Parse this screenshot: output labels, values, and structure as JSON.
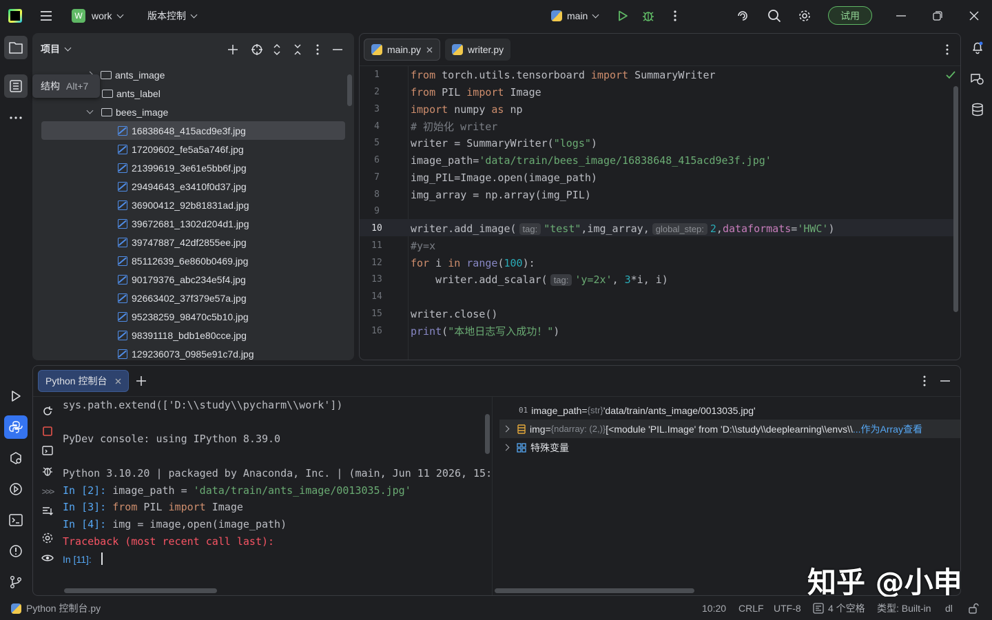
{
  "titlebar": {
    "project_badge": "W",
    "project_name": "work",
    "vcs_label": "版本控制",
    "run_config": "main",
    "trial_label": "试用"
  },
  "tooltip": {
    "label": "结构",
    "shortcut": "Alt+7"
  },
  "project_panel": {
    "title": "项目",
    "folders": [
      "ants_image",
      "ants_label",
      "bees_image"
    ],
    "files": [
      "16838648_415acd9e3f.jpg",
      "17209602_fe5a5a746f.jpg",
      "21399619_3e61e5bb6f.jpg",
      "29494643_e3410f0d37.jpg",
      "36900412_92b81831ad.jpg",
      "39672681_1302d204d1.jpg",
      "39747887_42df2855ee.jpg",
      "85112639_6e860b0469.jpg",
      "90179376_abc234e5f4.jpg",
      "92663402_37f379e57a.jpg",
      "95238259_98470c5b10.jpg",
      "98391118_bdb1e80cce.jpg",
      "129236073_0985e91c7d.jpg"
    ]
  },
  "editor": {
    "tabs": [
      "main.py",
      "writer.py"
    ],
    "line_numbers": [
      "1",
      "2",
      "3",
      "4",
      "5",
      "6",
      "7",
      "8",
      "9",
      "10",
      "11",
      "12",
      "13",
      "14",
      "15",
      "16"
    ],
    "code": {
      "l1_kw1": "from",
      "l1_mod": " torch.utils.tensorboard ",
      "l1_kw2": "import",
      "l1_name": " SummaryWriter",
      "l2_kw1": "from",
      "l2_mod": " PIL ",
      "l2_kw2": "import",
      "l2_name": " Image",
      "l3_kw1": "import",
      "l3_mod": " numpy ",
      "l3_kw2": "as",
      "l3_name": " np",
      "l4": "# 初始化 writer",
      "l5_a": "writer = SummaryWriter(",
      "l5_s": "\"logs\"",
      "l5_b": ")",
      "l6_a": "image_path=",
      "l6_s": "'data/train/bees_image/16838648_415acd9e3f.jpg'",
      "l7": "img_PIL=Image.open(image_path)",
      "l8": "img_array = np.array(img_PIL)",
      "l10_a": "writer.add_image(",
      "l10_h1": "tag:",
      "l10_s": "\"test\"",
      "l10_b": ",img_array,",
      "l10_h2": "global_step:",
      "l10_n": "2",
      "l10_c": ",",
      "l10_p": "dataformats",
      "l10_d": "=",
      "l10_s2": "'HWC'",
      "l10_e": ")",
      "l11": "#y=x",
      "l12_kw1": "for",
      "l12_a": " i ",
      "l12_kw2": "in",
      "l12_b": " ",
      "l12_f": "range",
      "l12_c": "(",
      "l12_n": "100",
      "l12_d": "):",
      "l13_a": "    writer.add_scalar(",
      "l13_h": "tag:",
      "l13_s": "'y=2x'",
      "l13_b": ", ",
      "l13_n": "3",
      "l13_c": "*i, i)",
      "l15": "writer.close()",
      "l16_f": "print",
      "l16_a": "(",
      "l16_s": "\"本地日志写入成功！\"",
      "l16_b": ")"
    }
  },
  "console": {
    "tab_label": "Python 控制台",
    "lines": {
      "c1": "sys.path.extend(['D:\\\\study\\\\pycharm\\\\work'])",
      "c2": "PyDev console: using IPython 8.39.0",
      "c3": "Python 3.10.20 | packaged by Anaconda, Inc. | (main, Jun 11 2026, 15:",
      "c4_p": "In [2]:",
      "c4_a": " image_path = ",
      "c4_s": "'data/train/ants_image/0013035.jpg'",
      "c5_p": "In [3]:",
      "c5_kw1": " from",
      "c5_a": " PIL ",
      "c5_kw2": "import",
      "c5_b": " Image",
      "c6_p": "In [4]:",
      "c6_a": " img = image,open(image_path)",
      "c7": "Traceback (most recent call last):",
      "c8_p": "In [11]:"
    },
    "variables": {
      "v1_name": "image_path",
      "v1_eq": " = ",
      "v1_type": "{str}",
      "v1_val": " 'data/train/ants_image/0013035.jpg'",
      "v2_name": "img",
      "v2_eq": " = ",
      "v2_type": "{ndarray: (2,)}",
      "v2_val": " [<module 'PIL.Image' from 'D:\\\\study\\\\deeplearning\\\\envs\\\\",
      "v2_link": "...作为Array查看",
      "v3_name": "特殊变量"
    }
  },
  "statusbar": {
    "left": "Python 控制台.py",
    "position": "10:20",
    "line_sep": "CRLF",
    "encoding": "UTF-8",
    "indent": "4 个空格",
    "type": "类型: Built-in",
    "extra": "dl"
  },
  "watermark": "知乎 @小申",
  "colors": {
    "accent": "#3574f0",
    "trial": "#5fb865",
    "keyword": "#cf8e6d",
    "string": "#6aab73",
    "number": "#2aacb8"
  }
}
